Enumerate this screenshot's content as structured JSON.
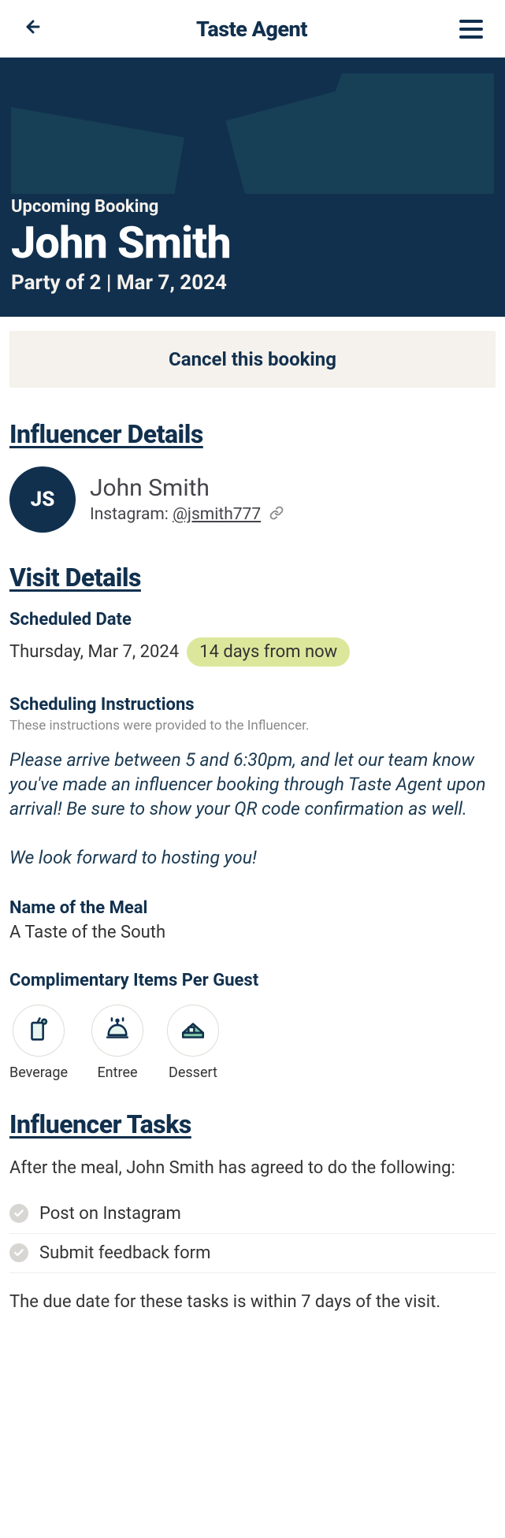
{
  "header": {
    "title": "Taste Agent"
  },
  "hero": {
    "eyebrow": "Upcoming Booking",
    "name": "John Smith",
    "subline": "Party of 2 | Mar 7, 2024"
  },
  "cancel_label": "Cancel this booking",
  "sections": {
    "influencer": "Influencer Details",
    "visit": "Visit Details",
    "tasks": "Influencer Tasks"
  },
  "influencer": {
    "initials": "JS",
    "name": "John Smith",
    "network_label": "Instagram: ",
    "handle": "@jsmith777"
  },
  "visit": {
    "scheduled_label": "Scheduled Date",
    "date": "Thursday, Mar 7, 2024",
    "relative": "14 days from now",
    "instructions_label": "Scheduling Instructions",
    "instructions_note": "These instructions were provided to the Influencer.",
    "instructions_body": "Please arrive between 5 and 6:30pm, and let our team know you've made an influencer booking through Taste Agent upon arrival! Be sure to show your QR code confirmation as well.\n\nWe look forward to hosting you!",
    "meal_label": "Name of the Meal",
    "meal_name": "A Taste of the South",
    "comp_label": "Complimentary Items Per Guest",
    "comp_items": {
      "beverage": "Beverage",
      "entree": "Entree",
      "dessert": "Dessert"
    }
  },
  "tasks": {
    "intro": "After the meal, John Smith has agreed to do the following:",
    "items": {
      "0": "Post on Instagram",
      "1": "Submit feedback form"
    },
    "due": "The due date for these tasks is within 7 days of the visit."
  }
}
